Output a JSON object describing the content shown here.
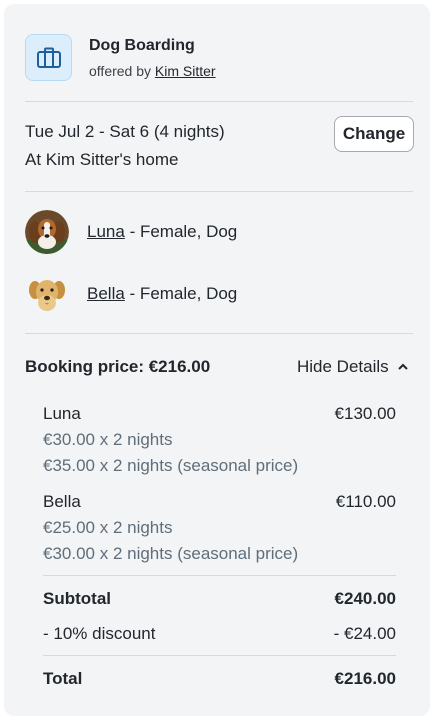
{
  "service": {
    "icon": "briefcase-icon",
    "title": "Dog Boarding",
    "offered_by_prefix": "offered by",
    "sitter_name": "Kim Sitter"
  },
  "dates": {
    "range": "Tue Jul 2 - Sat 6 (4 nights)",
    "location": "At Kim Sitter's home",
    "change_label": "Change"
  },
  "pets": [
    {
      "name": "Luna",
      "details": "- Female, Dog"
    },
    {
      "name": "Bella",
      "details": "- Female, Dog"
    }
  ],
  "booking": {
    "price_label": "Booking price: €216.00",
    "toggle_label": "Hide Details",
    "items": [
      {
        "pet": "Luna",
        "amount": "€130.00",
        "lines": [
          "€30.00 x 2 nights",
          "€35.00 x 2 nights (seasonal price)"
        ]
      },
      {
        "pet": "Bella",
        "amount": "€110.00",
        "lines": [
          "€25.00 x 2 nights",
          "€30.00 x 2 nights (seasonal price)"
        ]
      }
    ],
    "subtotal_label": "Subtotal",
    "subtotal_value": "€240.00",
    "discount_label": "- 10% discount",
    "discount_value": "- €24.00",
    "total_label": "Total",
    "total_value": "€216.00"
  },
  "colors": {
    "accent_icon_bg": "#dceefb",
    "muted_text": "#5f6e7a",
    "card_bg": "#f3f4f6"
  }
}
